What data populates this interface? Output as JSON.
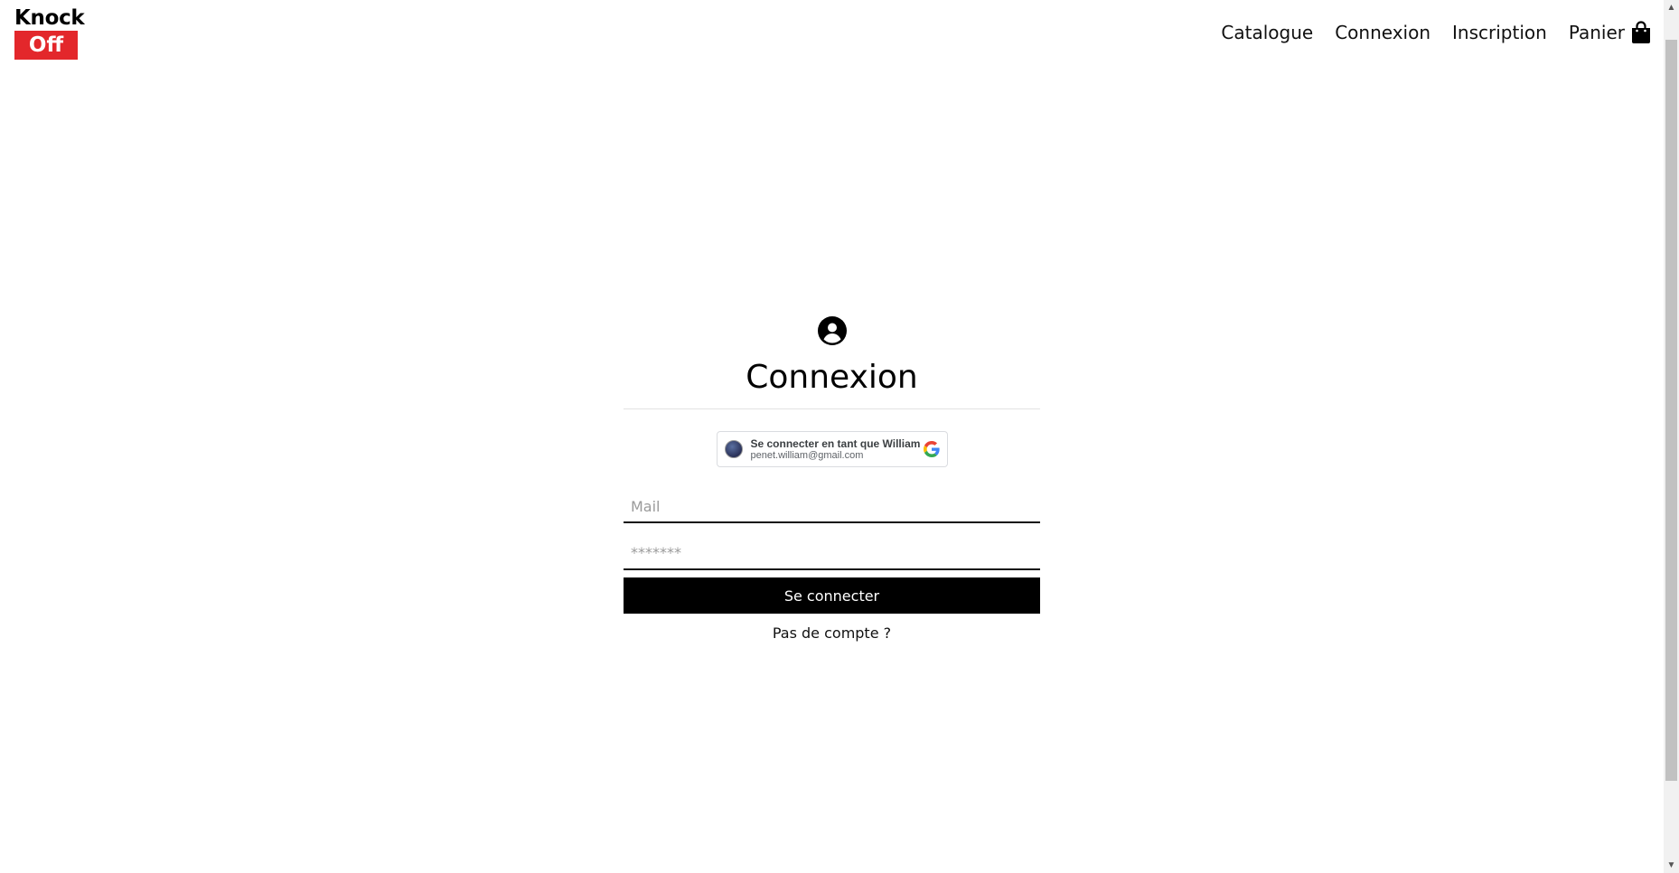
{
  "logo": {
    "line1": "Knock",
    "line2": "Off",
    "accent": "#e3272b"
  },
  "nav": {
    "catalogue": "Catalogue",
    "connexion": "Connexion",
    "inscription": "Inscription",
    "panier": "Panier",
    "cart_icon": "shopping-bag-icon"
  },
  "login": {
    "icon": "user-circle-icon",
    "title": "Connexion",
    "google": {
      "label": "Se connecter en tant que William",
      "email": "penet.william@gmail.com",
      "icon": "google-g-icon"
    },
    "mail_placeholder": "Mail",
    "password_placeholder": "*******",
    "submit_label": "Se connecter",
    "no_account": "Pas de compte ?"
  }
}
